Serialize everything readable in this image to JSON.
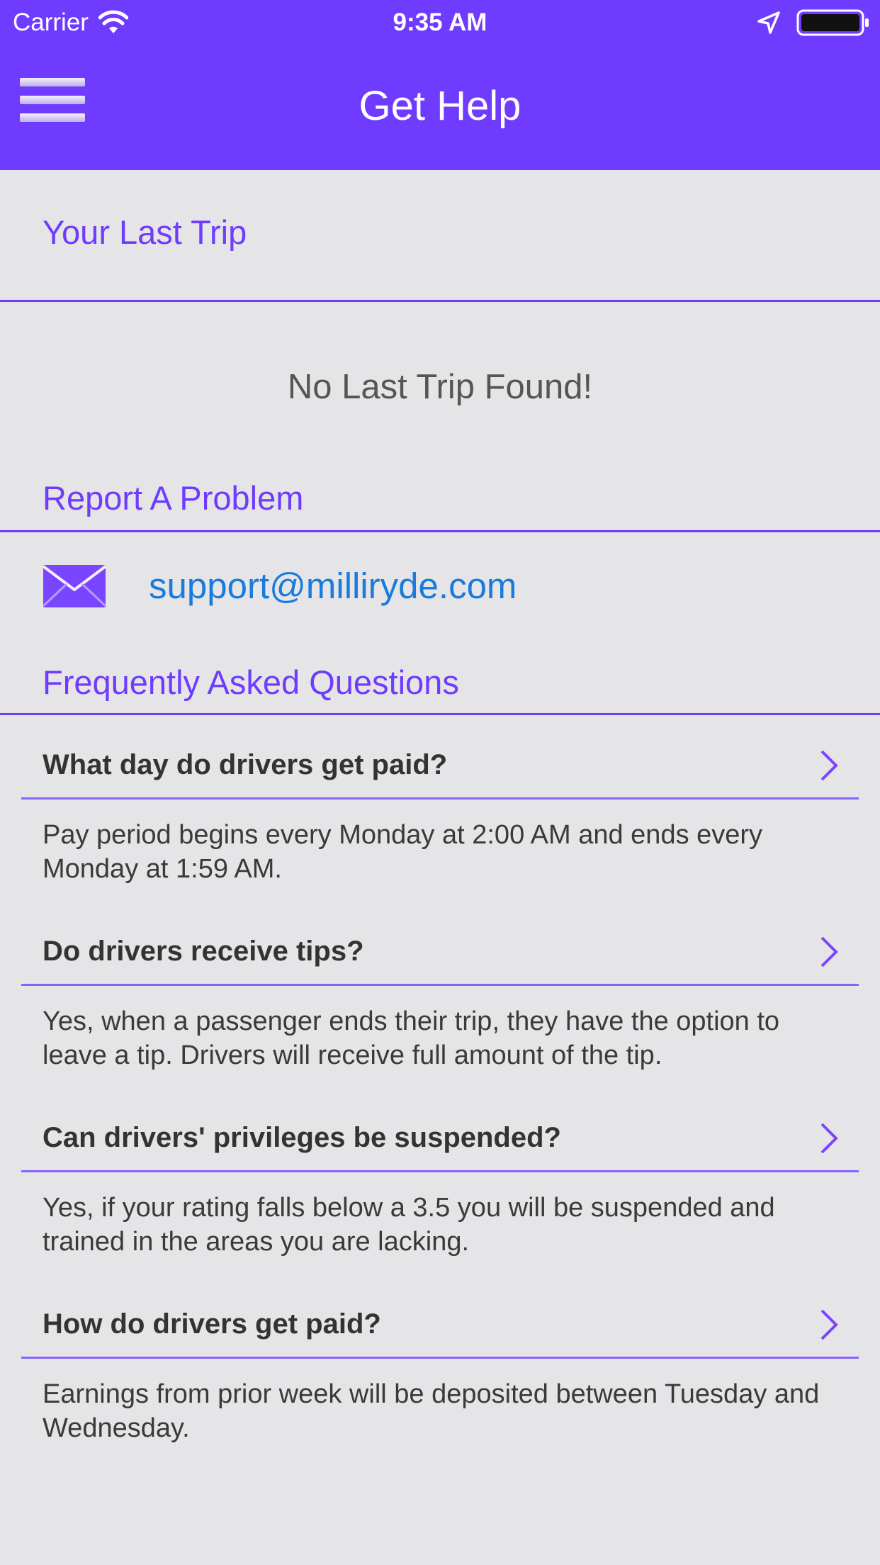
{
  "status_bar": {
    "carrier": "Carrier",
    "time": "9:35 AM",
    "icons": [
      "wifi-icon",
      "location-arrow-icon",
      "battery-icon"
    ]
  },
  "header": {
    "title": "Get Help",
    "menu_icon": "hamburger-menu-icon",
    "background_color": "#6e3bff"
  },
  "last_trip": {
    "heading": "Your Last Trip",
    "empty_message": "No Last Trip Found!"
  },
  "report": {
    "heading": "Report A Problem",
    "icon": "mail-icon",
    "email": "support@milliryde.com"
  },
  "faq": {
    "heading": "Frequently Asked Questions",
    "items": [
      {
        "question": "What day do drivers get paid?",
        "answer": "Pay period begins every Monday at 2:00 AM and ends every Monday at 1:59 AM."
      },
      {
        "question": "Do drivers receive tips?",
        "answer": "Yes, when a passenger ends their trip, they have the option to leave a tip. Drivers will receive full amount of the tip."
      },
      {
        "question": "Can drivers' privileges be suspended?",
        "answer": "Yes, if your rating falls below a 3.5 you will be suspended and trained in the areas you are lacking."
      },
      {
        "question": "How do drivers get paid?",
        "answer": "Earnings from prior week will be deposited between Tuesday and Wednesday."
      }
    ]
  },
  "colors": {
    "accent": "#6e3bff",
    "link": "#1a7bdc",
    "background": "#e5e5e7"
  }
}
